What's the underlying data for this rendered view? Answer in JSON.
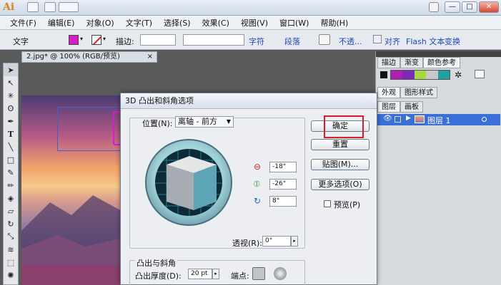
{
  "app": {
    "logo": "Ai"
  },
  "window_buttons": {
    "min": "—",
    "max": "□",
    "close": "✕"
  },
  "menu": [
    "文件(F)",
    "编辑(E)",
    "对象(O)",
    "文字(T)",
    "选择(S)",
    "效果(C)",
    "视图(V)",
    "窗口(W)",
    "帮助(H)"
  ],
  "control_bar": {
    "tool_label": "文字",
    "stroke_label": "描边:",
    "char_link": "字符",
    "para_link": "段落",
    "opacity_link": "不透...",
    "align_link": "对齐",
    "flash_text_link": "Flash 文本",
    "transform_link": "变换",
    "fill_color": "#d21fc9"
  },
  "document": {
    "tab_title": "2.jpg* @ 100% (RGB/预览)",
    "tab_close": "×"
  },
  "panel": {
    "tabs_top": [
      "描边",
      "渐变",
      "颜色参考"
    ],
    "tabs_mid": [
      "外观",
      "图形样式"
    ],
    "tabs_layers": [
      "图层",
      "画板"
    ],
    "layer_name": "图层 1",
    "swatch_colors": [
      "#b020b0",
      "#7a2ab8",
      "#a8d840",
      "#c8c8c8",
      "#20a0a0"
    ]
  },
  "dialog": {
    "title": "3D 凸出和斜角选项",
    "position_label": "位置(N):",
    "position_value": "离轴 - 前方",
    "ok_button": "确定",
    "reset_button": "重置",
    "map_button": "贴图(M)...",
    "more_button": "更多选项(O)",
    "preview_label": "预览(P)",
    "rot_x": "-18°",
    "rot_y": "-26°",
    "rot_z": "8°",
    "perspective_label": "透视(R):",
    "perspective_value": "0°",
    "extrude_group": "凸出与斜角",
    "depth_label": "凸出厚度(D):",
    "depth_value": "20 pt",
    "cap_label": "端点:",
    "highlight_color": "#d81c2a"
  }
}
